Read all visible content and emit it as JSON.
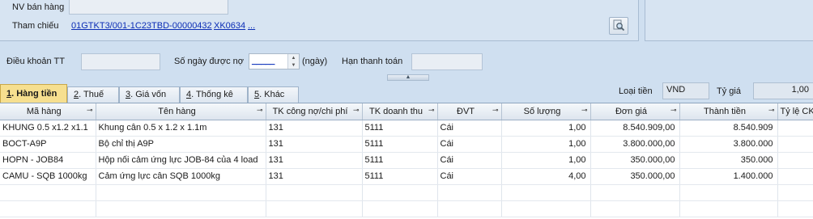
{
  "header": {
    "seller_label": "NV bán hàng",
    "seller_value": "",
    "reference_label": "Tham chiếu",
    "reference_links": [
      "01GTKT3/001-1C23TBD-00000432",
      "XK0634",
      "..."
    ]
  },
  "terms": {
    "payment_terms_label": "Điều khoản TT",
    "payment_terms_value": "",
    "credit_days_label": "Số ngày được nợ",
    "credit_days_value": "_____",
    "credit_days_unit": "(ngày)",
    "due_date_label": "Hạn thanh toán",
    "due_date_value": ""
  },
  "tabs": [
    {
      "key": "1",
      "label": ". Hàng tiền",
      "active": true
    },
    {
      "key": "2",
      "label": ". Thuế",
      "active": false
    },
    {
      "key": "3",
      "label": ". Giá vốn",
      "active": false
    },
    {
      "key": "4",
      "label": ". Thống kê",
      "active": false
    },
    {
      "key": "5",
      "label": ". Khác",
      "active": false
    }
  ],
  "currency": {
    "label": "Loại tiền",
    "value": "VND",
    "rate_label": "Tỷ giá",
    "rate_value": "1,00"
  },
  "grid": {
    "columns": [
      "Mã hàng",
      "Tên hàng",
      "TK công nợ/chi phí",
      "TK doanh thu",
      "ĐVT",
      "Số lượng",
      "Đơn giá",
      "Thành tiền",
      "Tỷ lệ CK"
    ],
    "rows": [
      [
        "KHUNG 0.5 x1.2 x1.1",
        "Khung cân 0.5 x 1.2 x 1.1m",
        "131",
        "5111",
        "Cái",
        "1,00",
        "8.540.909,00",
        "8.540.909",
        ""
      ],
      [
        "BOCT-A9P",
        "Bộ chỉ thị A9P",
        "131",
        "5111",
        "Cái",
        "1,00",
        "3.800.000,00",
        "3.800.000",
        ""
      ],
      [
        "HOPN - JOB84",
        "Hộp nối cảm ứng lực JOB-84 của 4 load",
        "131",
        "5111",
        "Cái",
        "1,00",
        "350.000,00",
        "350.000",
        ""
      ],
      [
        "CAMU - SQB 1000kg",
        "Cảm ứng lực cân SQB 1000kg",
        "131",
        "5111",
        "Cái",
        "4,00",
        "350.000,00",
        "1.400.000",
        ""
      ],
      [
        "",
        "",
        "",
        "",
        "",
        "",
        "",
        "",
        ""
      ],
      [
        "",
        "",
        "",
        "",
        "",
        "",
        "",
        "",
        ""
      ]
    ]
  },
  "icons": {
    "search": "search-icon",
    "pin": "pin-icon",
    "collapse": "chevron-up-icon"
  }
}
